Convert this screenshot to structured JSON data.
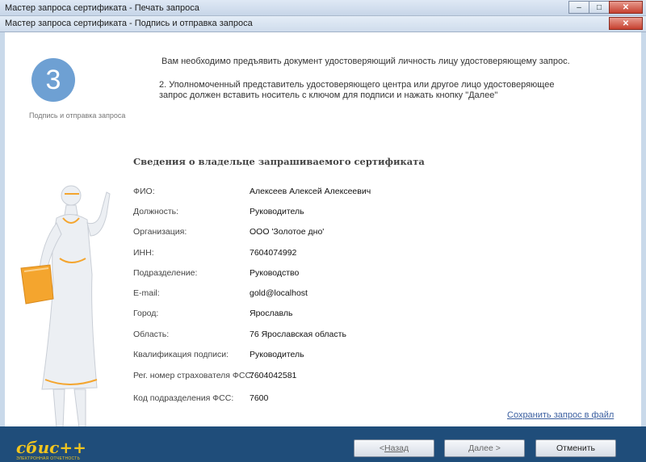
{
  "window": {
    "outer_title": "Мастер запроса сертификата - Печать запроса",
    "inner_title": "Мастер запроса сертификата - Подпись и отправка запроса",
    "minimize_glyph": "–",
    "maximize_glyph": "□",
    "close_glyph": "✕"
  },
  "step": {
    "number": "3",
    "label": "Подпись и отправка запроса"
  },
  "instructions": {
    "line1": "Вам необходимо предъявить документ удостоверяющий личность лицу удостоверяющему запрос.",
    "line2": "2. Уполномоченный представитель удостоверяющего центра или другое лицо удостоверяющее запрос должен вставить носитель с ключом для подписи и нажать кнопку \"Далее\""
  },
  "owner_info": {
    "title": "Сведения о владельце запрашиваемого сертификата",
    "fields": [
      {
        "label": "ФИО:",
        "value": "Алексеев Алексей Алексеевич"
      },
      {
        "label": "Должность:",
        "value": "Руководитель"
      },
      {
        "label": "Организация:",
        "value": "ООО 'Золотое дно'"
      },
      {
        "label": "ИНН:",
        "value": "7604074992"
      },
      {
        "label": "Подразделение:",
        "value": "Руководство"
      },
      {
        "label": "E-mail:",
        "value": "gold@localhost"
      },
      {
        "label": "Город:",
        "value": "Ярославль"
      },
      {
        "label": "Область:",
        "value": "76 Ярославская область"
      },
      {
        "label": "Квалификация подписи:",
        "value": "Руководитель"
      },
      {
        "label": "Рег. номер страхователя ФСС:",
        "value": "7604042581"
      },
      {
        "label": "Код подразделения ФСС:",
        "value": "7600"
      }
    ]
  },
  "save_link": "Сохранить запрос в файл",
  "footer": {
    "logo": "сбис++",
    "logo_sub": "ЭЛЕКТРОННАЯ ОТЧЕТНОСТЬ",
    "back_arrow": "< ",
    "back_label": "Назад",
    "next_label": "Далее >",
    "cancel_label": "Отменить"
  },
  "colors": {
    "accent": "#6ea0d3",
    "footer_bg": "#1f4d7a",
    "logo": "#f2c51e",
    "folder": "#f4a52e"
  }
}
